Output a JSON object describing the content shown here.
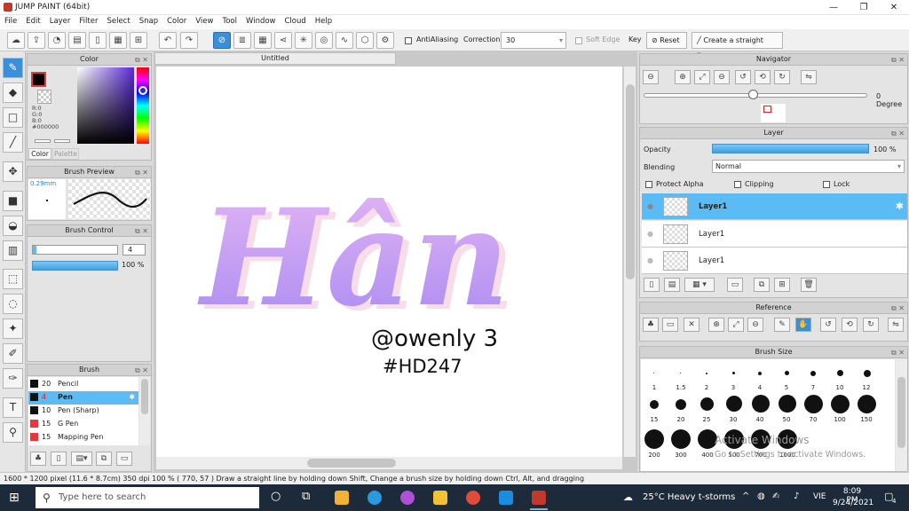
{
  "window": {
    "title": "JUMP PAINT (64bit)",
    "min": "—",
    "max": "❐",
    "close": "✕"
  },
  "menu": [
    "File",
    "Edit",
    "Layer",
    "Filter",
    "Select",
    "Snap",
    "Color",
    "View",
    "Tool",
    "Window",
    "Cloud",
    "Help"
  ],
  "toolbar": {
    "antialiasing": "AntiAliasing",
    "correction_label": "Correction",
    "correction_value": "30",
    "soft_edge": "Soft Edge",
    "key_label": "Key",
    "reset_label": "Reset",
    "straight_line_label": "Create a straight line"
  },
  "color_panel": {
    "title": "Color",
    "r": "R:0",
    "g": "G:0",
    "b": "B:0",
    "hex": "#000000",
    "tab_color": "Color",
    "tab_palette": "Palette",
    "fg_color": "#000000"
  },
  "brush_preview": {
    "title": "Brush Preview",
    "size": "0.29mm"
  },
  "brush_control": {
    "title": "Brush Control",
    "size_value": "4",
    "opacity_value": "100 %"
  },
  "brush_panel": {
    "title": "Brush",
    "items": [
      {
        "size": "20",
        "name": "Pencil",
        "color": "#111111"
      },
      {
        "size": "4",
        "name": "Pen",
        "color": "#111111"
      },
      {
        "size": "10",
        "name": "Pen (Sharp)",
        "color": "#111111"
      },
      {
        "size": "15",
        "name": "G Pen",
        "color": "#e0393e"
      },
      {
        "size": "15",
        "name": "Mapping Pen",
        "color": "#e0393e"
      }
    ]
  },
  "canvas": {
    "tab_title": "Untitled",
    "artwork_title": "Hân",
    "signature_line1": "@owenly 3",
    "signature_line2": "#HD247"
  },
  "navigator": {
    "title": "Navigator",
    "angle": "0 Degree"
  },
  "layer_panel": {
    "title": "Layer",
    "opacity_label": "Opacity",
    "opacity_value": "100 %",
    "blending_label": "Blending",
    "blending_value": "Normal",
    "protect_alpha": "Protect Alpha",
    "clipping": "Clipping",
    "lock": "Lock",
    "layers": [
      "Layer1",
      "Layer1",
      "Layer1"
    ]
  },
  "reference": {
    "title": "Reference"
  },
  "brush_size": {
    "title": "Brush Size",
    "row1": [
      "1",
      "1.5",
      "2",
      "3",
      "4",
      "5",
      "7",
      "10",
      "12"
    ],
    "row2": [
      "15",
      "20",
      "25",
      "30",
      "40",
      "50",
      "70",
      "100",
      "150"
    ],
    "row3": [
      "200",
      "300",
      "400",
      "500",
      "700",
      "1000"
    ]
  },
  "watermark": {
    "line1": "Activate Windows",
    "line2": "Go to Settings to activate Windows."
  },
  "status": "1600 * 1200 pixel   (11.6 * 8.7cm)   350 dpi   100 %   ( 770, 57 )   Draw a straight line by holding down Shift, Change a brush size by holding down Ctrl, Alt, and dragging",
  "taskbar": {
    "search_placeholder": "Type here to search",
    "weather": "25°C  Heavy t-storms",
    "lang": "VIE",
    "time": "8:09 PM",
    "date": "9/24/2021",
    "notif": "4"
  }
}
